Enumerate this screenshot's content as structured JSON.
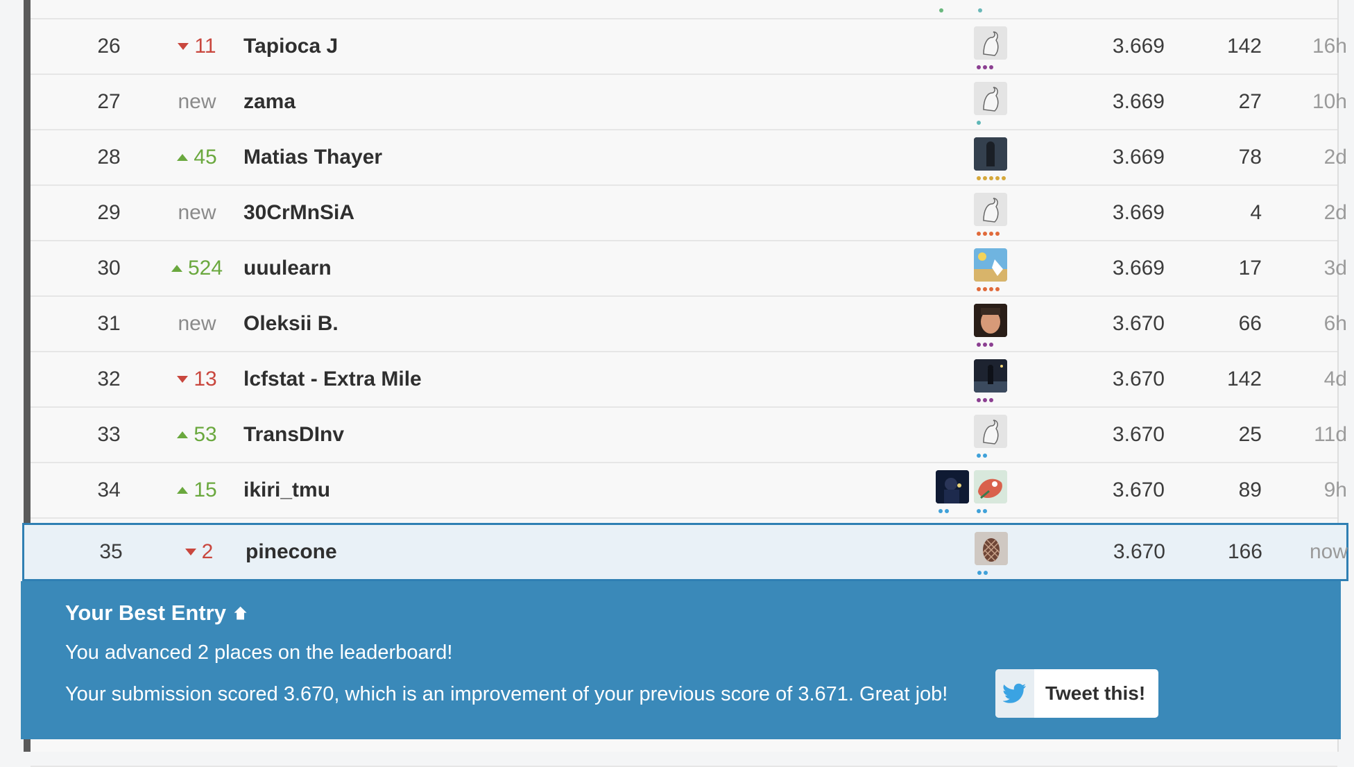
{
  "leaderboard": {
    "rows": [
      {
        "rank": "26",
        "change_dir": "down",
        "change": "11",
        "name": "Tapioca J",
        "score": "3.669",
        "entries": "142",
        "last": "16h"
      },
      {
        "rank": "27",
        "change_dir": "new",
        "change": "new",
        "name": "zama",
        "score": "3.669",
        "entries": "27",
        "last": "10h"
      },
      {
        "rank": "28",
        "change_dir": "up",
        "change": "45",
        "name": "Matias Thayer",
        "score": "3.669",
        "entries": "78",
        "last": "2d"
      },
      {
        "rank": "29",
        "change_dir": "new",
        "change": "new",
        "name": "30CrMnSiA",
        "score": "3.669",
        "entries": "4",
        "last": "2d"
      },
      {
        "rank": "30",
        "change_dir": "up",
        "change": "524",
        "name": "uuulearn",
        "score": "3.669",
        "entries": "17",
        "last": "3d"
      },
      {
        "rank": "31",
        "change_dir": "new",
        "change": "new",
        "name": "Oleksii B.",
        "score": "3.670",
        "entries": "66",
        "last": "6h"
      },
      {
        "rank": "32",
        "change_dir": "down",
        "change": "13",
        "name": "lcfstat - Extra Mile",
        "score": "3.670",
        "entries": "142",
        "last": "4d"
      },
      {
        "rank": "33",
        "change_dir": "up",
        "change": "53",
        "name": "TransDInv",
        "score": "3.670",
        "entries": "25",
        "last": "11d"
      },
      {
        "rank": "34",
        "change_dir": "up",
        "change": "15",
        "name": "ikiri_tmu",
        "score": "3.670",
        "entries": "89",
        "last": "9h"
      },
      {
        "rank": "35",
        "change_dir": "down",
        "change": "2",
        "name": "pinecone",
        "score": "3.670",
        "entries": "166",
        "last": "now"
      }
    ]
  },
  "banner": {
    "title": "Your Best Entry",
    "message1": "You advanced 2 places on the leaderboard!",
    "message2": "Your submission scored 3.670, which is an improvement of your previous score of 3.671. Great job!",
    "tweet_label": "Tweet this!"
  },
  "icons": {
    "arrow_up": "arrow-up-icon",
    "twitter": "twitter-icon",
    "tri_up": "triangle-up-icon",
    "tri_down": "triangle-down-icon"
  },
  "colors": {
    "banner": "#3a89b9",
    "up": "#6aa83e",
    "down": "#c9473e",
    "highlight_border": "#2f7fb3"
  }
}
